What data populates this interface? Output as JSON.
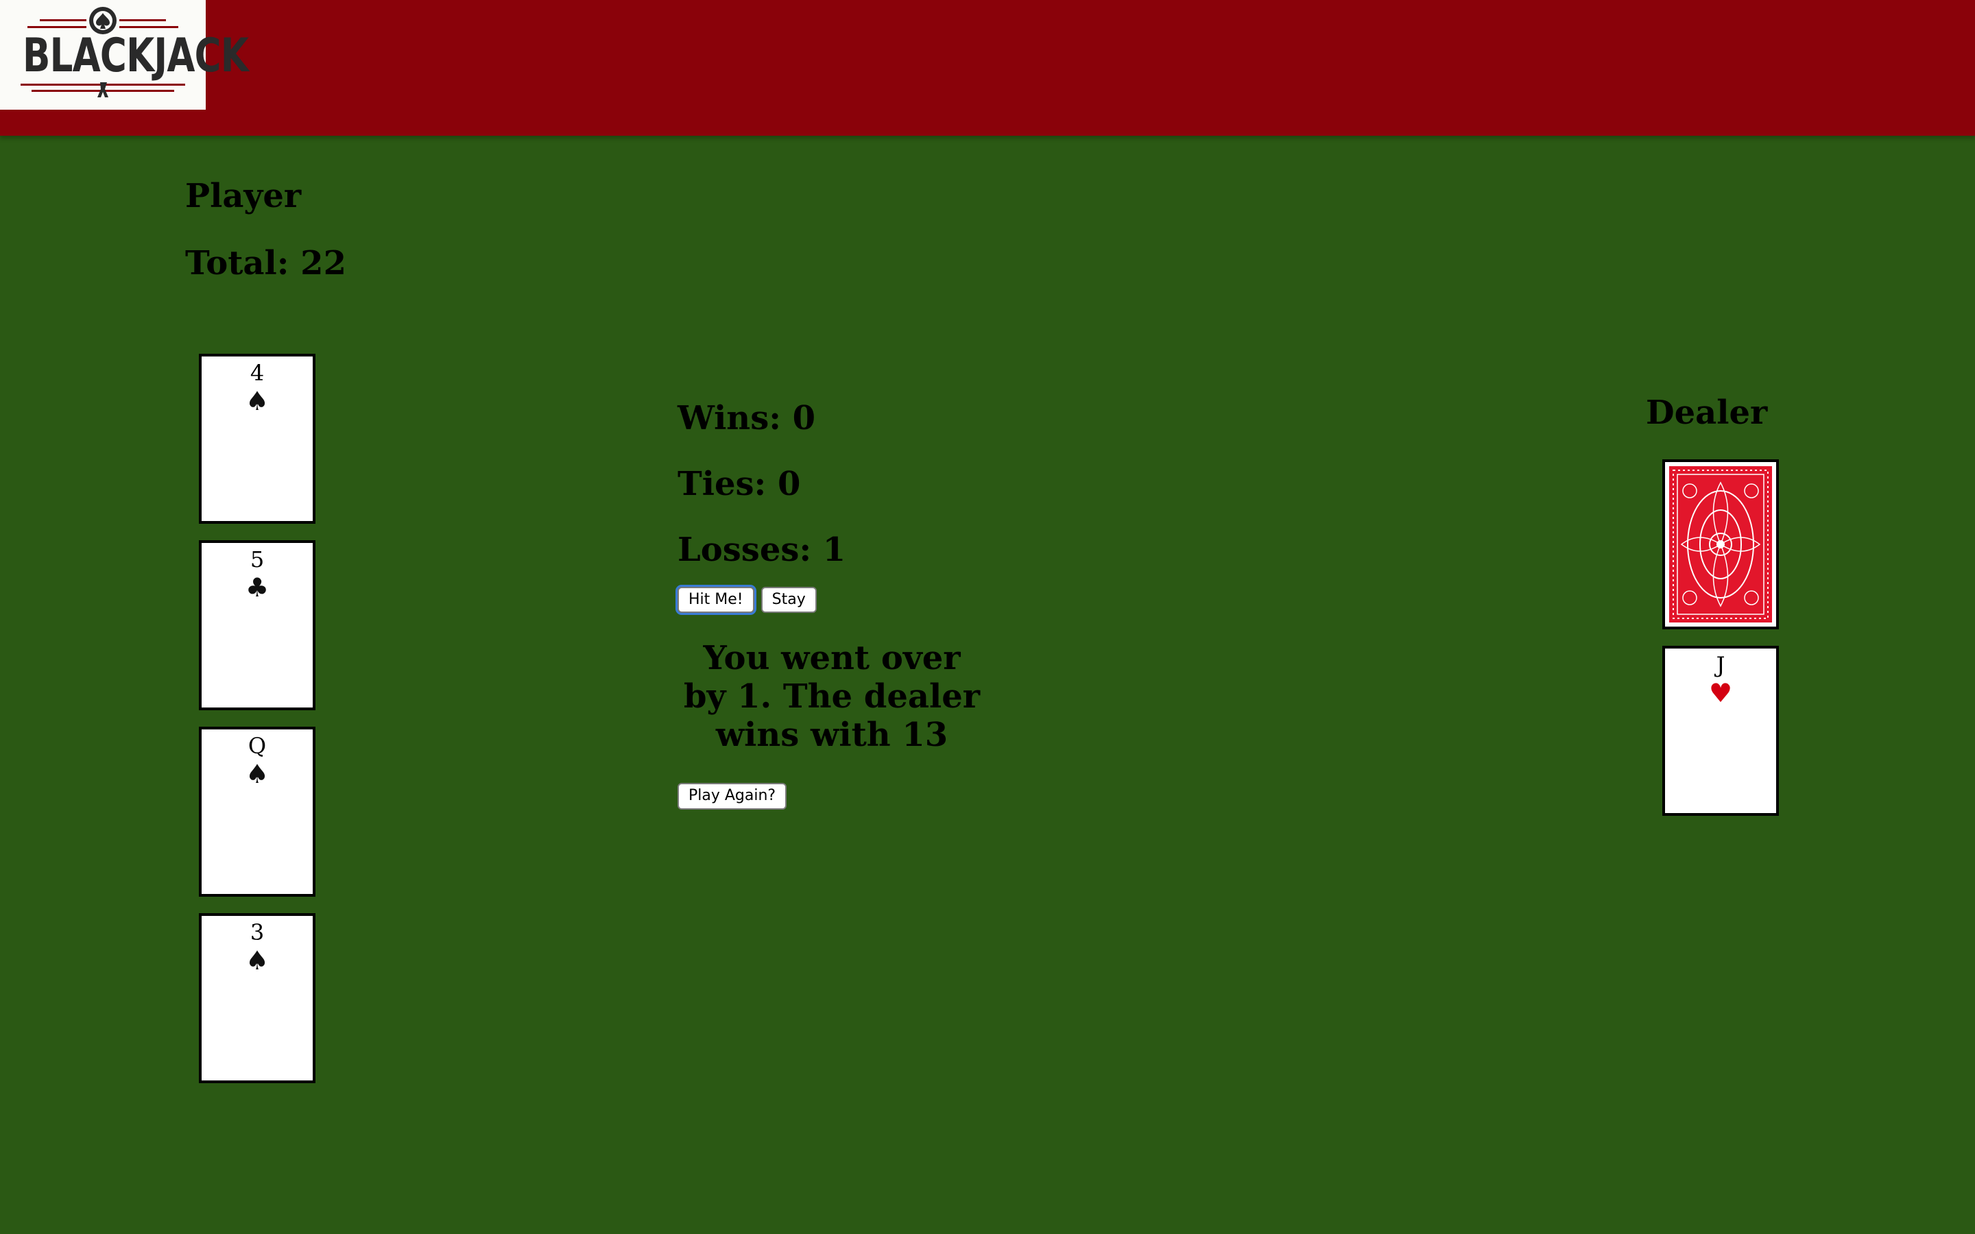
{
  "header": {
    "logo_text": "BLACKJACK",
    "bar_color": "#8a020a",
    "table_color": "#2b5914"
  },
  "player": {
    "heading": "Player",
    "total_label": "Total: 22",
    "cards": [
      {
        "rank": "4",
        "suit": "♠",
        "suit_name": "spade"
      },
      {
        "rank": "5",
        "suit": "♣",
        "suit_name": "club"
      },
      {
        "rank": "Q",
        "suit": "♠",
        "suit_name": "spade"
      },
      {
        "rank": "3",
        "suit": "♠",
        "suit_name": "spade"
      }
    ]
  },
  "scoreboard": {
    "wins": "Wins: 0",
    "ties": "Ties: 0",
    "losses": "Losses: 1"
  },
  "controls": {
    "hit_label": "Hit Me!",
    "stay_label": "Stay",
    "play_again_label": "Play Again?"
  },
  "result": {
    "message": "You went over by 1. The dealer wins with 13"
  },
  "dealer": {
    "heading": "Dealer",
    "hidden_card": "card-back",
    "cards": [
      {
        "rank": "J",
        "suit": "♥",
        "suit_name": "heart"
      }
    ]
  }
}
